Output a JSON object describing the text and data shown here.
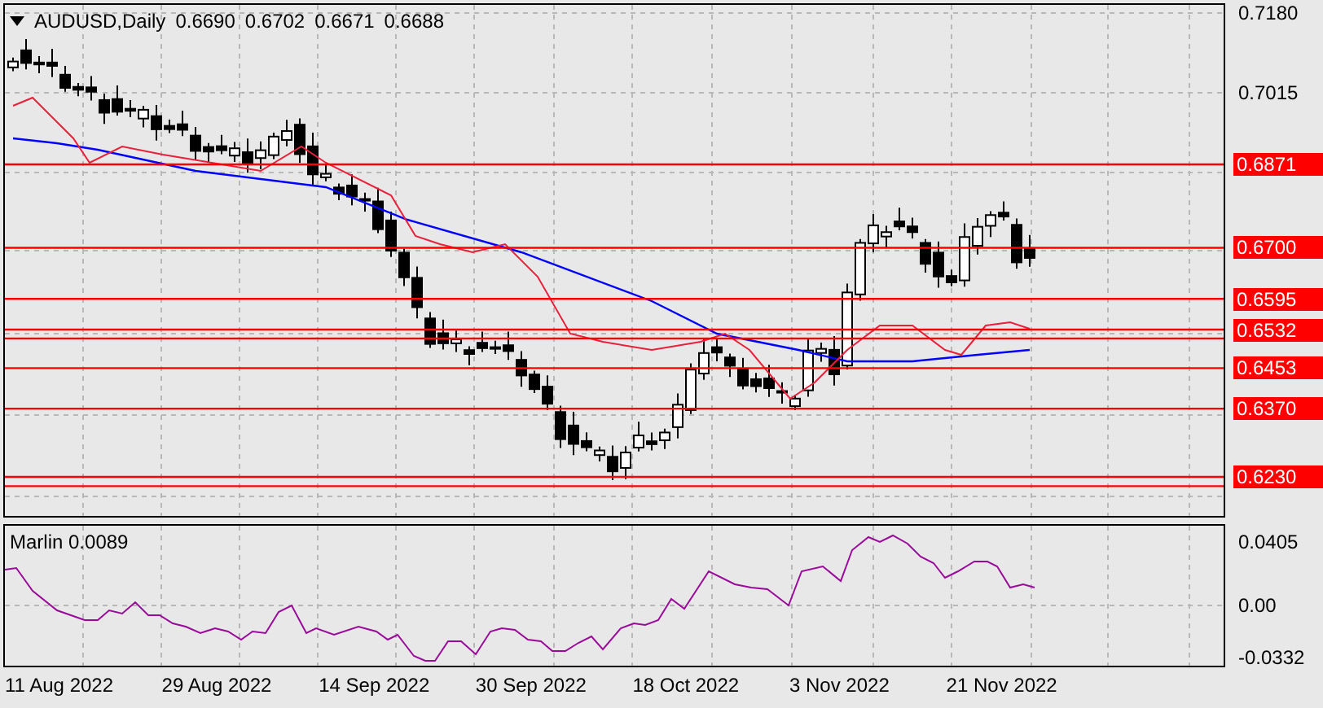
{
  "header": {
    "title": "AUDUSD,Daily",
    "quotes": [
      "0.6690",
      "0.6702",
      "0.6671",
      "0.6688"
    ]
  },
  "price_axis": {
    "ticks": [
      "0.7180",
      "0.7015"
    ]
  },
  "levels": [
    {
      "label": "0.6871"
    },
    {
      "label": "0.6700"
    },
    {
      "label": "0.6595"
    },
    {
      "label": "0.6532"
    },
    {
      "label": "0.6453"
    },
    {
      "label": "0.6370"
    },
    {
      "label": "0.6230"
    }
  ],
  "indicator": {
    "title": "Marlin 0.0089",
    "ticks": [
      "0.0405",
      "0.00",
      "-0.0332"
    ]
  },
  "dates": [
    "11 Aug 2022",
    "29 Aug 2022",
    "14 Sep 2022",
    "30 Sep 2022",
    "18 Oct 2022",
    "3 Nov 2022",
    "21 Nov 2022"
  ]
}
